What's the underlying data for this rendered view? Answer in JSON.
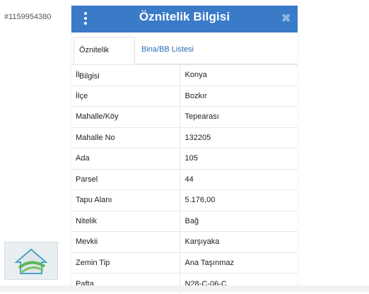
{
  "listing_id": "#1159954380",
  "dialog": {
    "title": "Öznitelik Bilgisi",
    "menu_icon": "more-vertical-icon",
    "close_icon": "close-icon",
    "close_glyph": "✖"
  },
  "tabs": [
    {
      "label": "Öznitelik Bilgisi",
      "active": true
    },
    {
      "label": "Bina/BB Listesi",
      "active": false
    }
  ],
  "rows": [
    {
      "label": "İl",
      "value": "Konya"
    },
    {
      "label": "İlçe",
      "value": "Bozkır"
    },
    {
      "label": "Mahalle/Köy",
      "value": "Tepearası"
    },
    {
      "label": "Mahalle No",
      "value": "132205"
    },
    {
      "label": "Ada",
      "value": "105"
    },
    {
      "label": "Parsel",
      "value": "44"
    },
    {
      "label": "Tapu Alanı",
      "value": "5.176,00"
    },
    {
      "label": "Nitelik",
      "value": "Bağ"
    },
    {
      "label": "Mevkii",
      "value": "Karşıyaka"
    },
    {
      "label": "Zemin Tip",
      "value": "Ana Taşınmaz"
    },
    {
      "label": "Pafta",
      "value": "N28-C-06-C"
    }
  ],
  "colors": {
    "titlebar": "#3a7bc8",
    "tab_link": "#2a6ab8"
  }
}
